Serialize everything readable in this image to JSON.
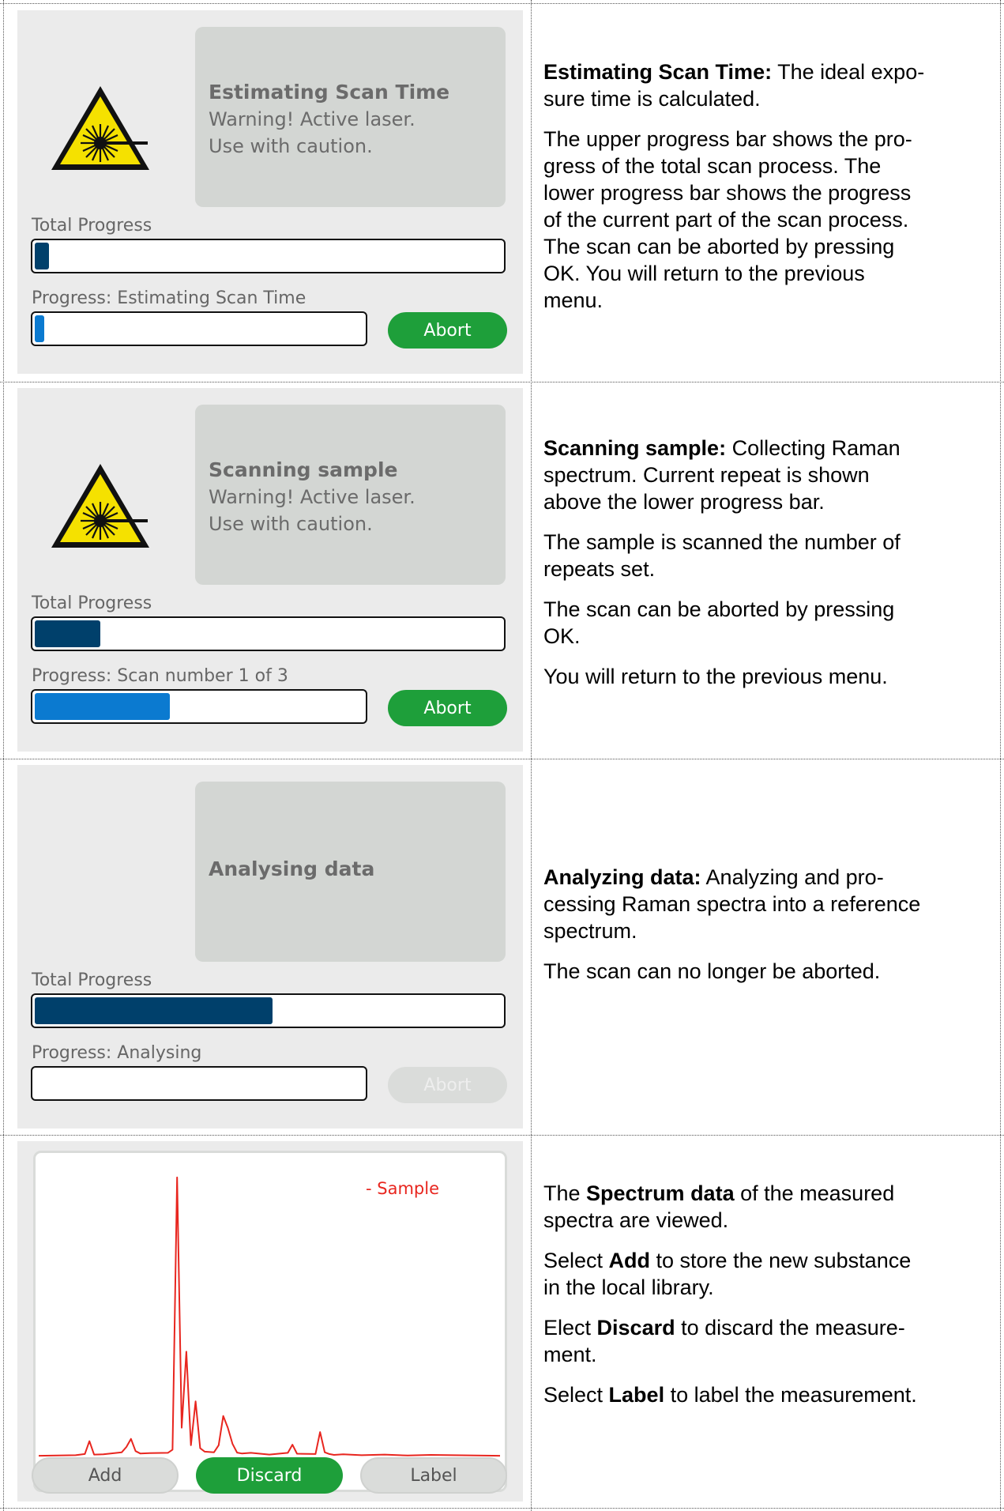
{
  "colors": {
    "panel_bg": "#d3d6d3",
    "screen_bg": "#ebebeb",
    "progress_total": "#00406b",
    "progress_current": "#0b7ad0",
    "button_green": "#1e9f3a",
    "spectrum_line": "#e8261f"
  },
  "rows": [
    {
      "screen": {
        "panel_title": "Estimating Scan Time",
        "panel_warning_1": "Warning! Active laser.",
        "panel_warning_2": "Use with caution.",
        "warning_icon": "laser-warning-icon",
        "total_label": "Total Progress",
        "total_progress": 0.03,
        "current_label": "Progress: Estimating Scan Time",
        "current_progress": 0.02,
        "button": "Abort"
      },
      "desc": {
        "p1_bold": "Estimating Scan Time:",
        "p1_l1": " The ideal expo-",
        "p1_l2": "sure time is calculated.",
        "p2_l1": "The upper progress bar shows the pro-",
        "p2_l2": "gress of the total scan process. The",
        "p2_l3": "lower progress bar shows the progress",
        "p2_l4": "of the current part of the scan process.",
        "p2_l5": "The scan can be aborted by pressing",
        "p2_l6": "OK. You will return to the previous",
        "p2_l7": "menu."
      }
    },
    {
      "screen": {
        "panel_title": "Scanning sample",
        "panel_warning_1": "Warning! Active laser.",
        "panel_warning_2": "Use with caution.",
        "warning_icon": "laser-warning-icon",
        "total_label": "Total Progress",
        "total_progress": 0.14,
        "current_label": "Progress:  Scan number  1 of 3",
        "current_progress": 0.41,
        "button": "Abort"
      },
      "desc": {
        "p1_bold": "Scanning sample:",
        "p1_l1": " Collecting Raman",
        "p1_l2": "spectrum. Current repeat is shown",
        "p1_l3": "above the lower progress bar.",
        "p2_l1": "The sample is scanned the number of",
        "p2_l2": "repeats set.",
        "p3_l1": "The scan can be aborted by pressing",
        "p3_l2": "OK.",
        "p4_l1": "You will return to the previous menu."
      }
    },
    {
      "screen": {
        "panel_title": "Analysing data",
        "total_label": "Total Progress",
        "total_progress": 0.51,
        "current_label": "Progress: Analysing",
        "current_progress": 0,
        "button": "Abort"
      },
      "desc": {
        "p1_bold": "Analyzing data:",
        "p1_l1": " Analyzing and pro-",
        "p1_l2": "cessing Raman spectra into a reference",
        "p1_l3": "spectrum.",
        "p2_l1": "The scan can no longer be aborted."
      }
    },
    {
      "screen": {
        "legend": "- Sample",
        "buttons": [
          "Add",
          "Discard",
          "Label"
        ]
      },
      "desc": {
        "p1_pre": "The ",
        "p1_bold": "Spectrum data",
        "p1_post": " of the measured",
        "p1_l2": "spectra are viewed.",
        "p2_pre": "Select ",
        "p2_bold": "Add",
        "p2_post": " to store the new substance",
        "p2_l2": "in the local library.",
        "p3_pre": "Elect ",
        "p3_bold": "Discard",
        "p3_post": " to discard the measure-",
        "p3_l2": "ment.",
        "p4_pre": "Select ",
        "p4_bold": "Label",
        "p4_post": " to label the measurement."
      }
    }
  ],
  "chart_data": {
    "type": "line",
    "xlabel": "",
    "ylabel": "",
    "xlim": [
      0,
      100
    ],
    "ylim": [
      0,
      100
    ],
    "series": [
      {
        "name": "- Sample",
        "x": [
          0,
          8,
          10,
          11,
          12,
          14,
          18,
          19,
          20,
          21,
          22,
          24,
          28,
          29,
          30,
          31,
          32,
          33,
          34,
          35,
          36,
          38,
          39,
          40,
          41,
          42,
          43,
          44,
          46,
          48,
          50,
          54,
          55,
          56,
          60,
          61,
          62,
          63,
          64,
          66,
          70,
          75,
          80,
          85,
          90,
          95,
          100
        ],
        "y": [
          2.4,
          2.6,
          3.0,
          7.4,
          2.8,
          2.9,
          3.6,
          5.4,
          8.2,
          4.0,
          3.2,
          3.3,
          3.4,
          4.5,
          97.6,
          12.0,
          38.0,
          6.0,
          21.0,
          5.0,
          3.8,
          3.6,
          6.0,
          16.0,
          12.0,
          6.5,
          3.5,
          3.2,
          3.4,
          3.1,
          2.8,
          3.4,
          6.2,
          3.1,
          3.0,
          10.5,
          3.6,
          3.0,
          2.7,
          2.9,
          2.6,
          2.8,
          2.5,
          2.7,
          2.6,
          2.5,
          2.4
        ]
      }
    ]
  }
}
